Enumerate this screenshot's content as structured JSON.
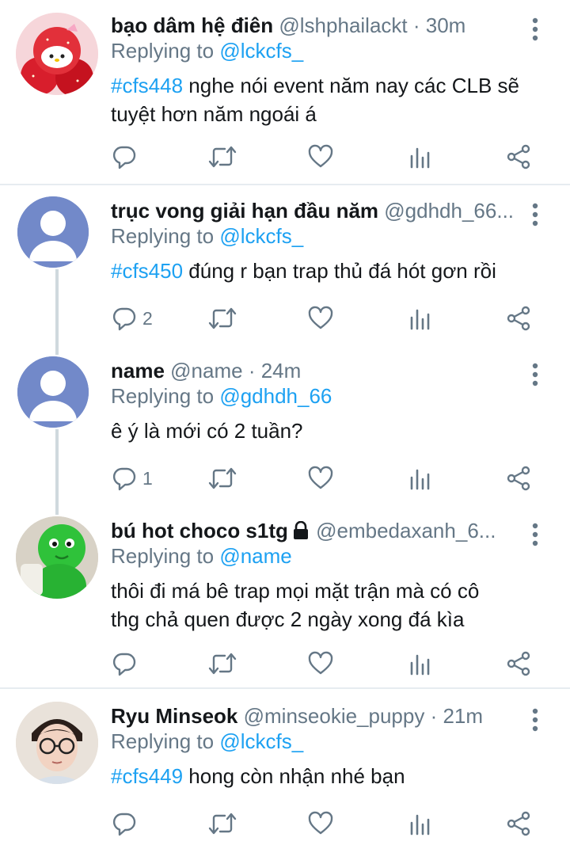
{
  "tweets": [
    {
      "name": "bạo dâm hệ điên",
      "handle": "@lshphailackt",
      "time": "30m",
      "replying_label": "Replying to",
      "replying_to": "@lckcfs_",
      "hashtag": "#cfs448",
      "body_line1": " nghe nói event năm nay các CLB sẽ",
      "body_line2": "tuyệt hơn năm ngoái á",
      "reply_count": "",
      "avatar": "hello-kitty-strawberry"
    },
    {
      "name": "trục vong giải hạn đầu năm",
      "handle": "@gdhdh_66...",
      "time": "",
      "replying_label": "Replying to",
      "replying_to": "@lckcfs_",
      "hashtag": "#cfs450",
      "body_line1": " đúng r bạn trap thủ đá hót gơn rồi",
      "reply_count": "2",
      "avatar": "default-profile"
    },
    {
      "name": "name",
      "handle": "@name",
      "time": "24m",
      "replying_label": "Replying to",
      "replying_to": "@gdhdh_66",
      "body_line1": "ê ý là mới có 2 tuần?",
      "reply_count": "1",
      "avatar": "default-profile"
    },
    {
      "name": "bú hot choco s1tg",
      "handle": "@embedaxanh_6...",
      "time": "",
      "replying_label": "Replying to",
      "replying_to": "@name",
      "body_line1": "thôi đi má bê trap mọi mặt trận mà có cô",
      "body_line2": "thg chả quen được 2 ngày xong đá kìa",
      "reply_count": "",
      "avatar": "green-figure",
      "protected": true
    },
    {
      "name": "Ryu Minseok",
      "handle": "@minseokie_puppy",
      "time": "21m",
      "replying_label": "Replying to",
      "replying_to": "@lckcfs_",
      "hashtag": "#cfs449",
      "body_line1": " hong còn nhận nhé bạn",
      "reply_count": "",
      "avatar": "person-with-glasses"
    }
  ],
  "separator": " · ",
  "colors": {
    "accent": "#1da1f2",
    "muted": "#657786",
    "text": "#14171a",
    "divider": "#e6ecf0"
  },
  "icons": [
    "reply-icon",
    "retweet-icon",
    "like-icon",
    "analytics-icon",
    "share-icon",
    "more-icon",
    "lock-icon"
  ]
}
